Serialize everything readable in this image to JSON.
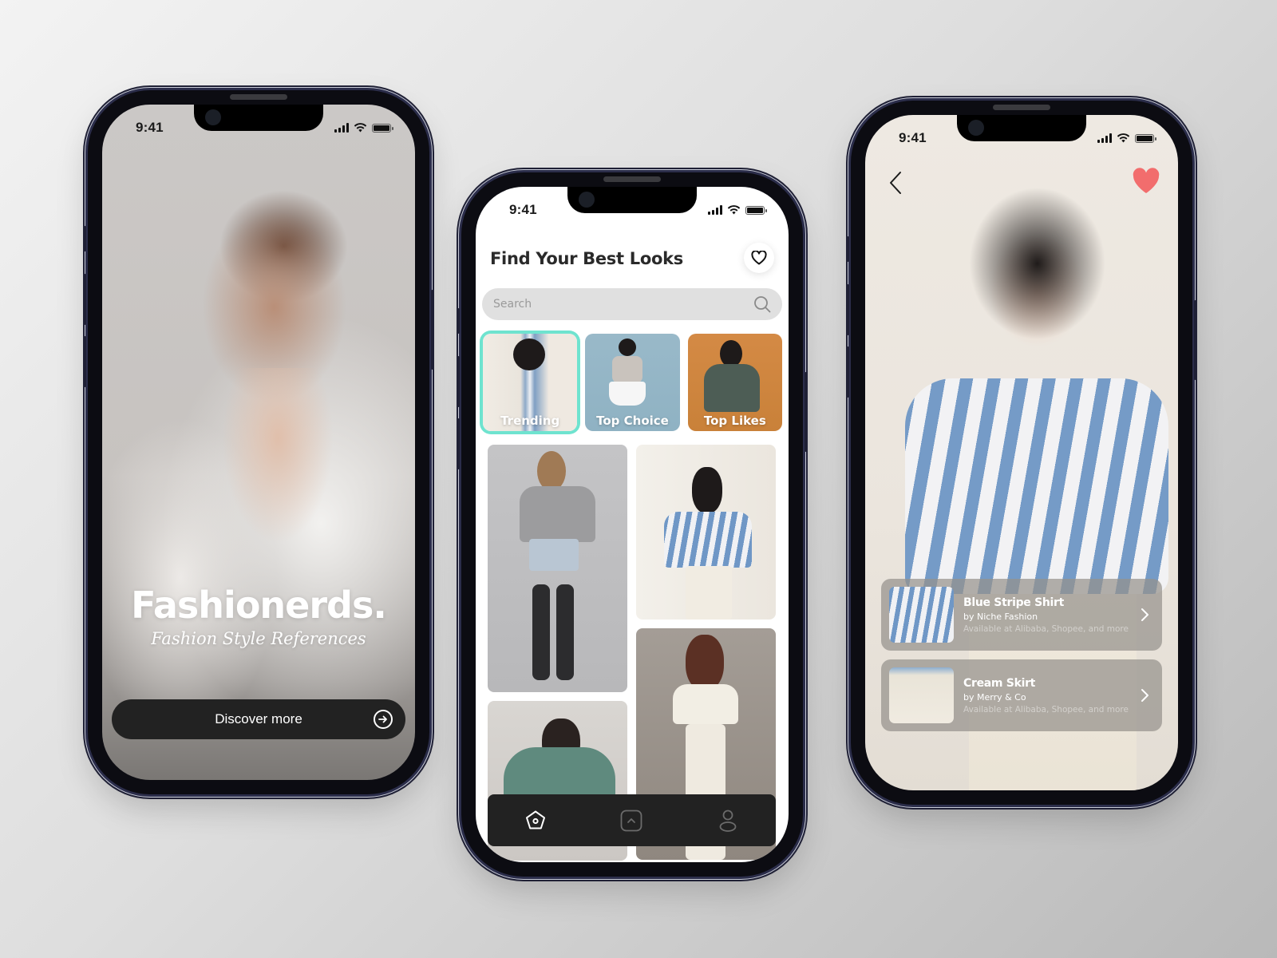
{
  "status_bar": {
    "time": "9:41"
  },
  "phone1": {
    "brand_title": "Fashionerds.",
    "brand_subtitle": "Fashion Style References",
    "cta_label": "Discover more",
    "cta_icon": "arrow-right-circle-icon"
  },
  "phone2": {
    "title": "Find Your Best Looks",
    "favorite_icon": "heart-outline-icon",
    "search": {
      "placeholder": "Search",
      "value": "",
      "icon": "search-icon"
    },
    "categories": [
      {
        "label": "Trending",
        "active": true
      },
      {
        "label": "Top Choice",
        "active": false
      },
      {
        "label": "Top Likes",
        "active": false
      }
    ],
    "gallery": [
      {
        "description": "Grey cropped hoodie with denim shorts and velvet thigh-high boots"
      },
      {
        "description": "Blue striped shirt with cream skirt"
      },
      {
        "description": "Green sage oversized sweatshirt"
      },
      {
        "description": "Cream cropped knit with white high-waist pants"
      }
    ],
    "tab_bar": [
      {
        "name": "home",
        "icon": "home-icon",
        "active": true
      },
      {
        "name": "upload",
        "icon": "chevron-up-square-icon",
        "active": false
      },
      {
        "name": "profile",
        "icon": "user-icon",
        "active": false
      }
    ]
  },
  "phone3": {
    "back_icon": "chevron-left-icon",
    "favorite_icon": "heart-filled-icon",
    "accent_color": "#f26d6d",
    "products": [
      {
        "name": "Blue Stripe Shirt",
        "brand": "by Niche Fashion",
        "availability": "Available at Alibaba, Shopee, and more"
      },
      {
        "name": "Cream Skirt",
        "brand": "by Merry & Co",
        "availability": "Available at Alibaba, Shopee, and more"
      }
    ]
  },
  "colors": {
    "active_category_border": "#6fe3cf",
    "dark_surface": "#222222",
    "heart_red": "#f26d6d"
  }
}
